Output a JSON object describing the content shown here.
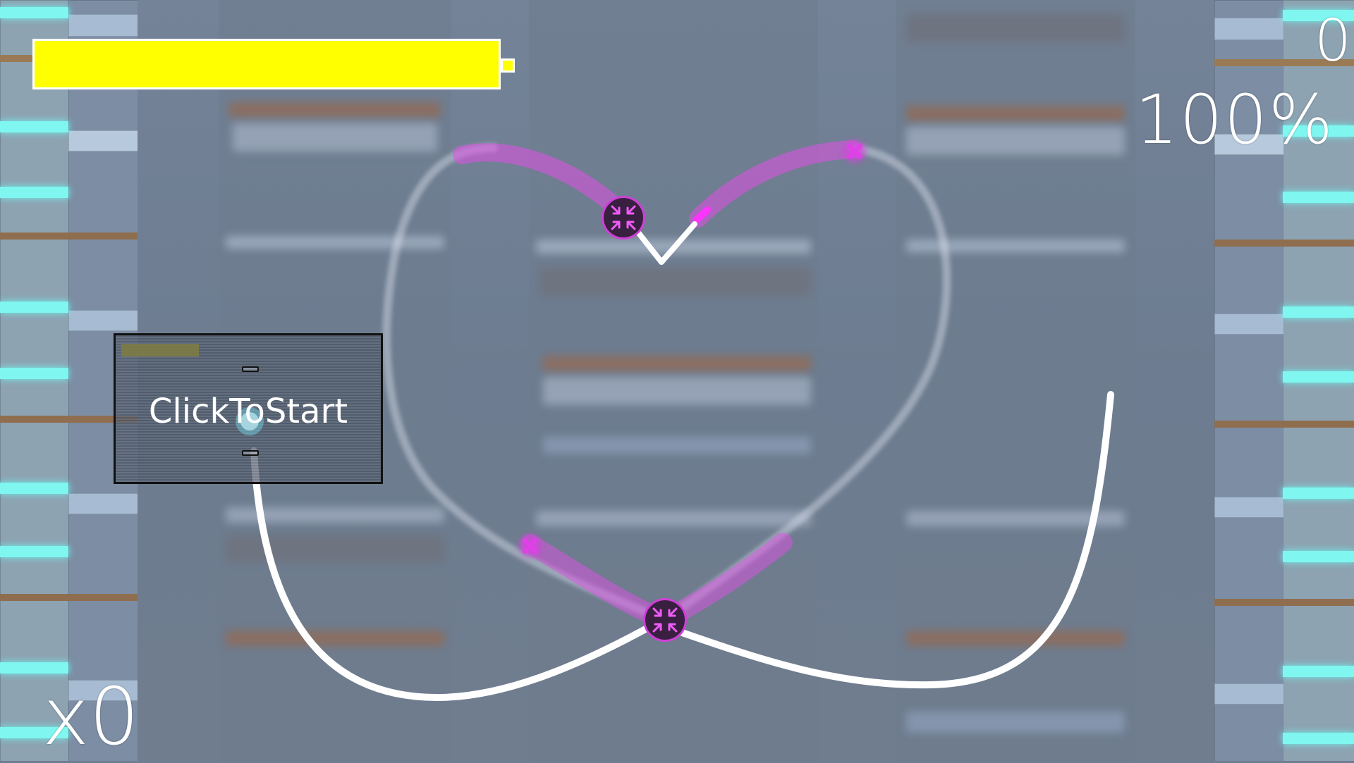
{
  "hud": {
    "score": "0",
    "accuracy": "100%",
    "combo": "x0",
    "health_level": 1.0
  },
  "start_panel": {
    "label": "ClickToStart"
  },
  "colors": {
    "health": "#ffff00",
    "note_accent": "#e033e6",
    "track": "#ffffff",
    "lane_glow": "#7ff6f0"
  },
  "icons": {
    "note": "compress-arrows-icon",
    "cursor": "cursor-orb-icon"
  }
}
